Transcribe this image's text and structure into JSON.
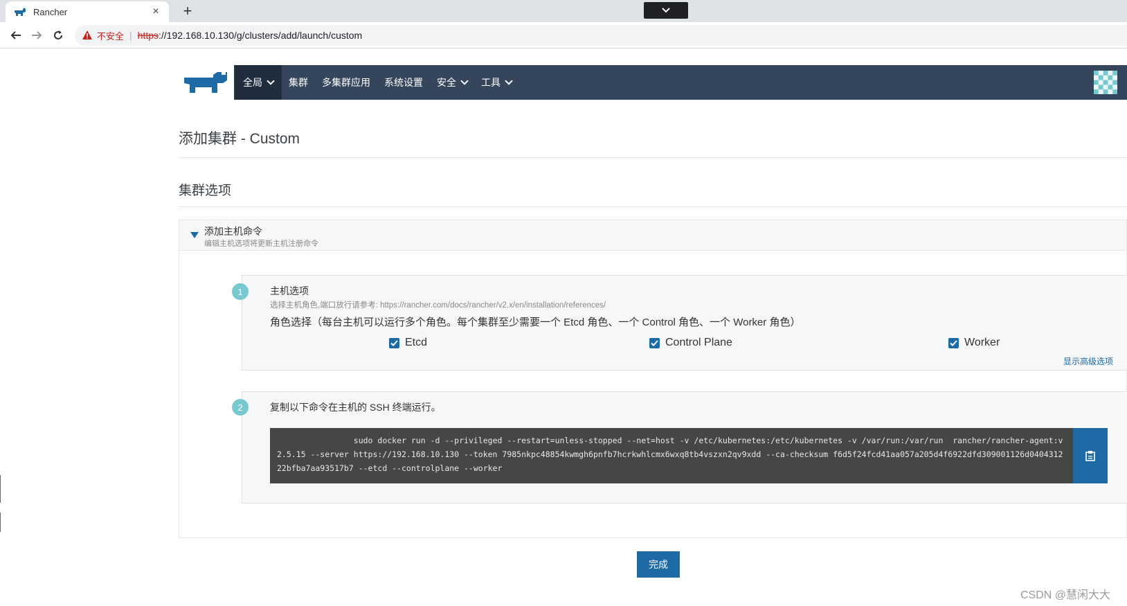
{
  "browser": {
    "tab_title": "Rancher",
    "tab_close": "×",
    "new_tab": "+",
    "insecure_label": "不安全",
    "url_scheme": "https",
    "url_rest": "://192.168.10.130/g/clusters/add/launch/custom"
  },
  "header": {
    "nav": [
      {
        "label": "全局",
        "active": true,
        "dropdown": true
      },
      {
        "label": "集群",
        "active": false,
        "dropdown": false
      },
      {
        "label": "多集群应用",
        "active": false,
        "dropdown": false
      },
      {
        "label": "系统设置",
        "active": false,
        "dropdown": false
      },
      {
        "label": "安全",
        "active": false,
        "dropdown": true
      },
      {
        "label": "工具",
        "active": false,
        "dropdown": true
      }
    ],
    "bg_color": "#35465c"
  },
  "page": {
    "title": "添加集群 - Custom",
    "section_title": "集群选项",
    "panel": {
      "title": "添加主机命令",
      "subtitle": "编辑主机选项将更新主机注册命令"
    },
    "step1": {
      "number": "1",
      "title": "主机选项",
      "reference": "选择主机角色,端口放行请参考: https://rancher.com/docs/rancher/v2.x/en/installation/references/",
      "role_line": "角色选择（每台主机可以运行多个角色。每个集群至少需要一个 Etcd 角色、一个 Control 角色、一个 Worker 角色）",
      "roles": [
        {
          "label": "Etcd",
          "checked": true
        },
        {
          "label": "Control Plane",
          "checked": true
        },
        {
          "label": "Worker",
          "checked": true
        }
      ],
      "advanced_link": "显示高级选项"
    },
    "step2": {
      "number": "2",
      "title": "复制以下命令在主机的 SSH 终端运行。",
      "command": "                sudo docker run -d --privileged --restart=unless-stopped --net=host -v /etc/kubernetes:/etc/kubernetes -v /var/run:/var/run  rancher/rancher-agent:v2.5.15 --server https://192.168.10.130 --token 7985nkpc48854kwmgh6pnfb7hcrkwhlcmx6wxq8tb4vszxn2qv9xdd --ca-checksum f6d5f24fcd41aa057a205d4f6922dfd309001126d040431222bfba7aa93517b7 --etcd --controlplane --worker"
    },
    "done_button": "完成"
  },
  "watermark": "CSDN @慧闲大大",
  "colors": {
    "primary": "#1d6aa5",
    "step_badge": "#78c9cf",
    "insecure": "#c5221f"
  }
}
